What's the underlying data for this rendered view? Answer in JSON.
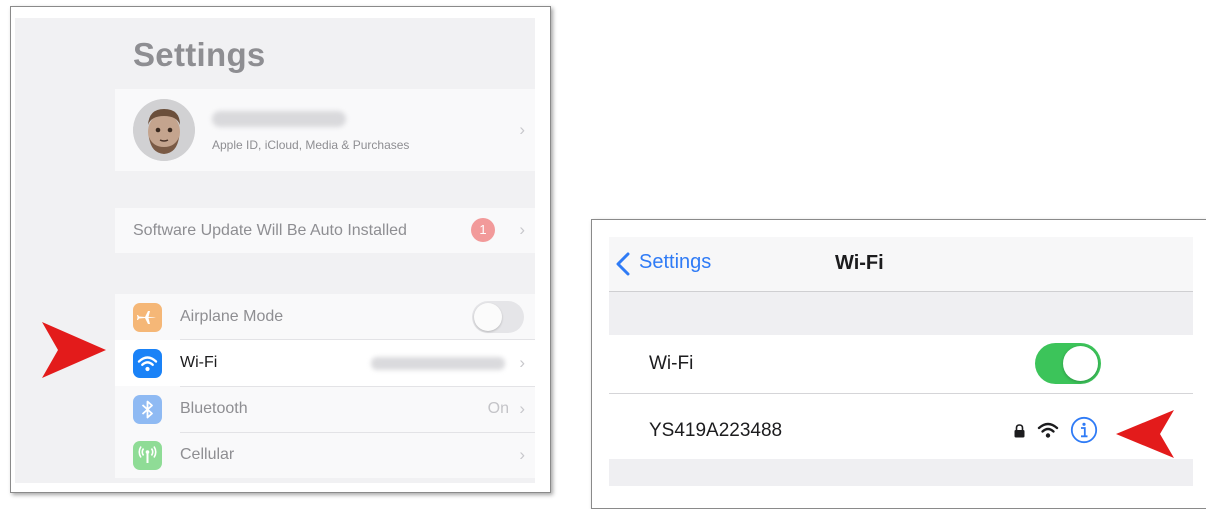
{
  "settings_panel": {
    "title": "Settings",
    "profile": {
      "subtitle": "Apple ID, iCloud, Media & Purchases"
    },
    "update_banner": {
      "label": "Software Update Will Be Auto Installed",
      "badge_count": "1"
    },
    "rows": [
      {
        "label": "Airplane Mode",
        "icon": "airplane-icon",
        "icon_color": "#f5b777",
        "control": "toggle-off"
      },
      {
        "label": "Wi-Fi",
        "icon": "wifi-icon",
        "icon_color": "#1a82f7",
        "selected": true
      },
      {
        "label": "Bluetooth",
        "icon": "bluetooth-icon",
        "icon_color": "#8fbaf3",
        "value": "On"
      },
      {
        "label": "Cellular",
        "icon": "cellular-icon",
        "icon_color": "#8fdc96"
      }
    ],
    "chevron": "›"
  },
  "wifi_panel": {
    "back_label": "Settings",
    "title": "Wi-Fi",
    "wifi_row": {
      "label": "Wi-Fi",
      "toggle": "on"
    },
    "network": {
      "ssid": "YS419A223488",
      "icons": [
        "lock-icon",
        "wifi-signal-icon",
        "info-icon"
      ]
    }
  },
  "colors": {
    "accent_blue": "#2f7bf6",
    "toggle_green": "#3cc45a",
    "pointer_red": "#e31b1b"
  }
}
